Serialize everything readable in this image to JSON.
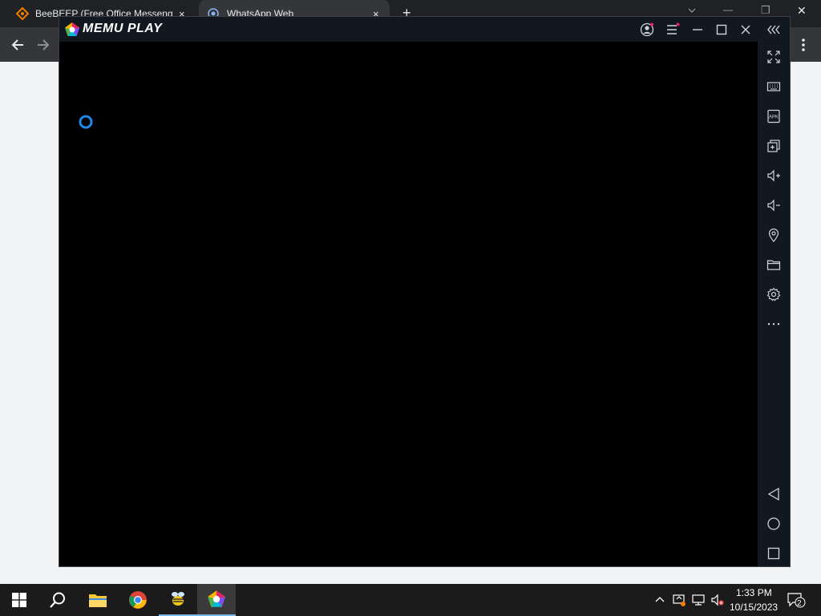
{
  "browser": {
    "tabs": [
      {
        "label": "BeeBEEP (Free Office Messenger)",
        "close": "×"
      },
      {
        "label": "WhatsApp Web",
        "close": "×"
      }
    ],
    "new_tab": "+",
    "window_controls": {
      "minimize": "—",
      "restore": "❐",
      "close": "✕"
    }
  },
  "memu": {
    "logo_text": "MEMU PLAY",
    "titlebar_icons": [
      "account-icon",
      "menu-icon",
      "minimize-icon",
      "maximize-icon",
      "close-icon",
      "collapse-sidebar-icon"
    ],
    "sidebar_top": [
      "fullscreen-icon",
      "keyboard-icon",
      "apk-icon",
      "multi-instance-icon",
      "volume-up-icon",
      "volume-down-icon",
      "location-icon",
      "folder-icon",
      "settings-icon",
      "more-icon"
    ],
    "sidebar_bottom": [
      "back-icon",
      "home-icon",
      "recents-icon"
    ],
    "apk_label": "APK"
  },
  "taskbar": {
    "time": "1:33 PM",
    "date": "10/15/2023",
    "notification_count": "2"
  },
  "colors": {
    "memu_chrome": "#111820",
    "spinner": "#1e88e5",
    "browser_bg": "#202124"
  }
}
